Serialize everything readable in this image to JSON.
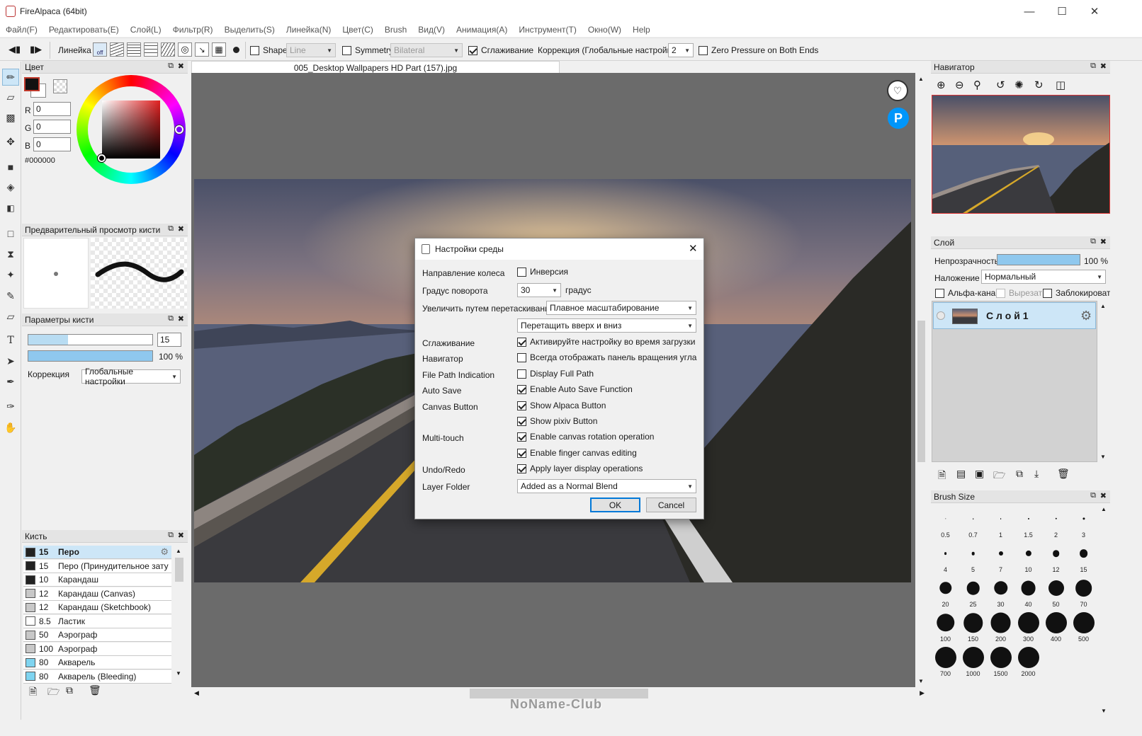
{
  "app": {
    "title": "FireAlpaca (64bit)"
  },
  "menu": [
    "Файл(F)",
    "Редактировать(E)",
    "Слой(L)",
    "Фильтр(R)",
    "Выделить(S)",
    "Линейка(N)",
    "Цвет(C)",
    "Brush",
    "Вид(V)",
    "Анимация(A)",
    "Инструмент(T)",
    "Окно(W)",
    "Help"
  ],
  "toolbar": {
    "ruler_label": "Линейка",
    "off_label": "off",
    "shape_label": "Shape",
    "shape_value": "Line",
    "symmetry_label": "Symmetry",
    "symmetry_value": "Bilateral",
    "smoothing_label": "Сглаживание",
    "correction_label": "Коррекция (Глобальные настройки)",
    "correction_value": "2",
    "zero_pressure_label": "Zero Pressure on Both Ends"
  },
  "color_panel": {
    "title": "Цвет",
    "r_label": "R",
    "g_label": "G",
    "b_label": "B",
    "r": "0",
    "g": "0",
    "b": "0",
    "hex": "#000000",
    "current_color": "#000000"
  },
  "brush_preview": {
    "title": "Предварительный просмотр кисти"
  },
  "brush_params": {
    "title": "Параметры кисти",
    "size": "15",
    "size_fraction": 0.32,
    "opacity": "100 %",
    "opacity_fraction": 1.0,
    "correction_label": "Коррекция",
    "correction_value": "Глобальные настройки"
  },
  "brush_list": {
    "title": "Кисть",
    "items": [
      {
        "size": "15",
        "name": "Перо",
        "color": "#222222",
        "selected": true
      },
      {
        "size": "15",
        "name": "Перо (Принудительное зату",
        "color": "#222222"
      },
      {
        "size": "10",
        "name": "Карандаш",
        "color": "#222222"
      },
      {
        "size": "12",
        "name": "Карандаш (Canvas)",
        "color": "#c8c8c8"
      },
      {
        "size": "12",
        "name": "Карандаш (Sketchbook)",
        "color": "#c8c8c8"
      },
      {
        "size": "8.5",
        "name": "Ластик",
        "color": "#ffffff"
      },
      {
        "size": "50",
        "name": "Аэрограф",
        "color": "#c8c8c8"
      },
      {
        "size": "100",
        "name": "Аэрограф",
        "color": "#c8c8c8"
      },
      {
        "size": "80",
        "name": "Акварель",
        "color": "#7fd4f0"
      },
      {
        "size": "80",
        "name": "Акварель (Bleeding)",
        "color": "#7fd4f0"
      }
    ]
  },
  "document": {
    "tab": "005_Desktop Wallpapers  HD Part (157).jpg"
  },
  "dialog": {
    "title": "Настройки среды",
    "wheel_label": "Направление колеса",
    "wheel_option": "Инверсия",
    "rotate_label": "Градус поворота",
    "rotate_value": "30",
    "rotate_unit": "градус",
    "drag_zoom_label": "Увеличить путем перетаскивания",
    "drag_zoom_value": "Плавное масштабирование",
    "drag_dir_value": "Перетащить вверх и вниз",
    "smoothing_label": "Сглаживание",
    "smoothing_option": "Активируйте настройку во время загрузки",
    "navigator_label": "Навигатор",
    "navigator_option": "Всегда отображать панель вращения угла",
    "filepath_label": "File Path Indication",
    "filepath_option": "Display Full Path",
    "autosave_label": "Auto Save",
    "autosave_option": "Enable Auto Save Function",
    "canvasbtn_label": "Canvas Button",
    "alpaca_option": "Show Alpaca Button",
    "pixiv_option": "Show pixiv Button",
    "multitouch_label": "Multi-touch",
    "rotation_option": "Enable canvas rotation operation",
    "finger_option": "Enable finger canvas editing",
    "undo_label": "Undo/Redo",
    "undo_option": "Apply layer display operations",
    "folder_label": "Layer Folder",
    "folder_value": "Added as a Normal Blend",
    "ok": "OK",
    "cancel": "Cancel"
  },
  "navigator": {
    "title": "Навигатор"
  },
  "layer_panel": {
    "title": "Слой",
    "opacity_label": "Непрозрачность",
    "opacity_value": "100 %",
    "opacity_fraction": 1.0,
    "blend_label": "Наложение",
    "blend_value": "Нормальный",
    "alpha_label": "Альфа-кана.",
    "clip_label": "Вырезать",
    "lock_label": "Заблокироваті",
    "layer_name": "С л о й 1"
  },
  "brush_size": {
    "title": "Brush Size",
    "sizes": [
      "0.5",
      "0.7",
      "1",
      "1.5",
      "2",
      "3",
      "4",
      "5",
      "7",
      "10",
      "12",
      "15",
      "20",
      "25",
      "30",
      "40",
      "50",
      "70",
      "100",
      "150",
      "200",
      "300",
      "400",
      "500",
      "700",
      "1000",
      "1500",
      "2000"
    ]
  },
  "watermark": "NoName-Club"
}
